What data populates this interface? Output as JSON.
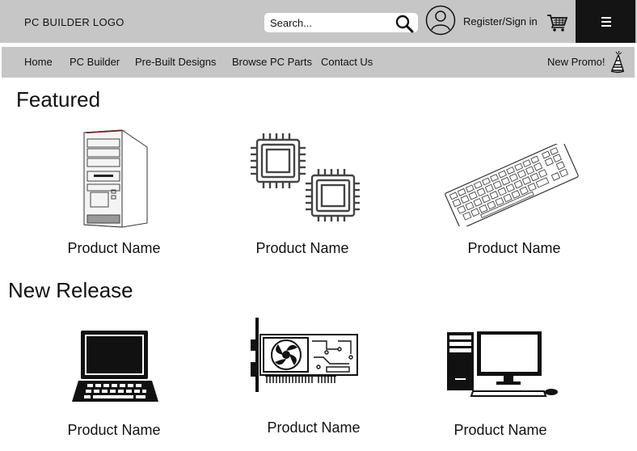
{
  "header": {
    "logo": "PC BUILDER  LOGO",
    "search_placeholder": "Search...",
    "register_label": "Register/Sign in",
    "icons": [
      "search-icon",
      "account-icon",
      "cart-icon",
      "menu-icon"
    ]
  },
  "nav": {
    "items": [
      "Home",
      "PC Builder",
      "Pre-Built Designs",
      "Browse PC Parts",
      "Contact Us"
    ],
    "promo_label": "New Promo!",
    "promo_icon": "party-hat-icon"
  },
  "featured": {
    "title": "Featured",
    "products": [
      {
        "name": "Product Name",
        "icon": "pc-tower-icon"
      },
      {
        "name": "Product Name",
        "icon": "cpu-chips-icon"
      },
      {
        "name": "Product Name",
        "icon": "keyboard-icon"
      }
    ]
  },
  "new_release": {
    "title": "New Release",
    "products": [
      {
        "name": "Product Name",
        "icon": "laptop-icon"
      },
      {
        "name": "Product Name",
        "icon": "graphics-card-icon"
      },
      {
        "name": "Product Name",
        "icon": "desktop-computer-icon"
      }
    ]
  },
  "colors": {
    "header_bg": "#c6c6c6",
    "menu_bg": "#141414",
    "page_bg": "#ffffff"
  }
}
